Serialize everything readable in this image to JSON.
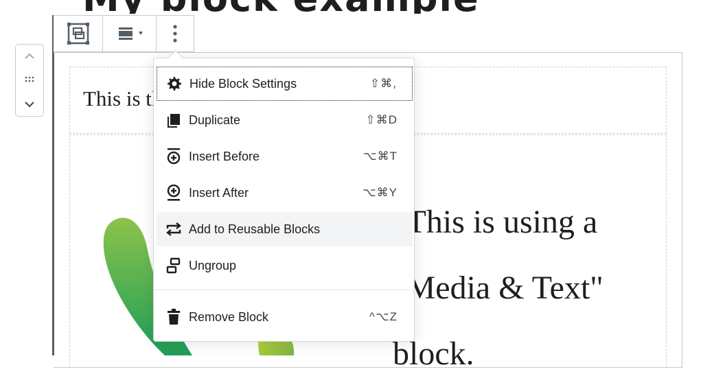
{
  "heading": {
    "text": "My block example"
  },
  "editor": {
    "paragraph_text": "This is the",
    "media_text_lines": [
      "\"This is using a",
      "\"Media & Text\"",
      "block."
    ]
  },
  "mover": {
    "up_icon": "chevron-up-icon",
    "drag_icon": "drag-handle-icon",
    "down_icon": "chevron-down-icon"
  },
  "toolbar": {
    "parent_icon": "group-block-icon",
    "align_icon": "align-center-icon",
    "more_icon": "more-vertical-icon"
  },
  "menu": {
    "items": [
      {
        "label": "Hide Block Settings",
        "shortcut": "⇧⌘,",
        "icon": "gear-icon"
      },
      {
        "label": "Duplicate",
        "shortcut": "⇧⌘D",
        "icon": "duplicate-icon"
      },
      {
        "label": "Insert Before",
        "shortcut": "⌥⌘T",
        "icon": "insert-before-icon"
      },
      {
        "label": "Insert After",
        "shortcut": "⌥⌘Y",
        "icon": "insert-after-icon"
      },
      {
        "label": "Add to Reusable Blocks",
        "shortcut": "",
        "icon": "reusable-icon"
      },
      {
        "label": "Ungroup",
        "shortcut": "",
        "icon": "ungroup-icon"
      },
      {
        "label": "Remove Block",
        "shortcut": "^⌥Z",
        "icon": "trash-icon"
      }
    ]
  },
  "colors": {
    "accent_dark": "#555d66",
    "hover_bg": "#f3f4f5",
    "leaf_green": "#4caf50"
  }
}
